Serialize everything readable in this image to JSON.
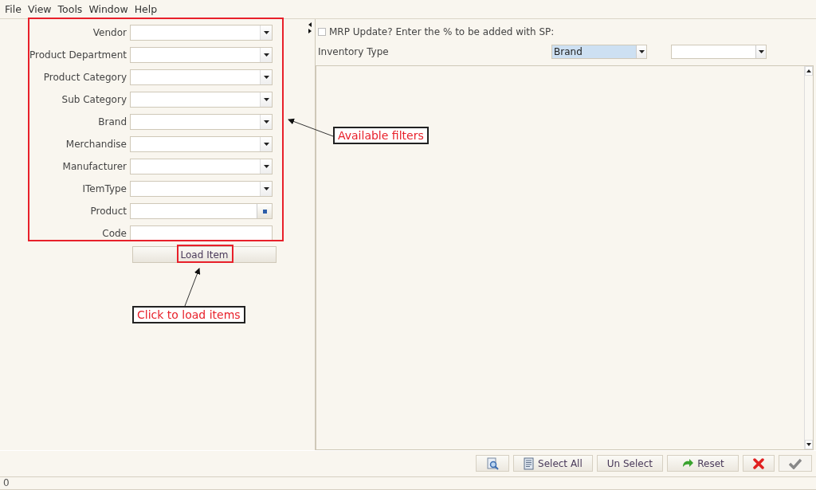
{
  "menu": [
    {
      "label": "File"
    },
    {
      "label": "View"
    },
    {
      "label": "Tools"
    },
    {
      "label": "Window"
    },
    {
      "label": "Help"
    }
  ],
  "filters": [
    {
      "label": "Vendor",
      "kind": "combo"
    },
    {
      "label": "Product Department",
      "kind": "combo"
    },
    {
      "label": "Product Category",
      "kind": "combo"
    },
    {
      "label": "Sub Category",
      "kind": "combo"
    },
    {
      "label": "Brand",
      "kind": "combo"
    },
    {
      "label": "Merchandise",
      "kind": "combo"
    },
    {
      "label": "Manufacturer",
      "kind": "combo"
    },
    {
      "label": "ITemType",
      "kind": "combo"
    },
    {
      "label": "Product",
      "kind": "lookup"
    },
    {
      "label": "Code",
      "kind": "text"
    }
  ],
  "load_button": {
    "label": "Load Item"
  },
  "mrp_update": {
    "label": "MRP Update? Enter the % to be added with SP:",
    "checked": false
  },
  "inventory_type": {
    "label": "Inventory Type",
    "value": "Brand"
  },
  "toolbar": [
    {
      "kind": "preview",
      "disabled": false
    },
    {
      "kind": "document",
      "label": "Select All",
      "disabled": false
    },
    {
      "kind": "plain",
      "label": "Un Select",
      "disabled": false
    },
    {
      "kind": "refresh",
      "label": "Reset",
      "disabled": false
    },
    {
      "kind": "close",
      "disabled": false
    },
    {
      "kind": "check",
      "disabled": true
    }
  ],
  "status_bar": {
    "text": "0"
  },
  "annotations": [
    {
      "kind": "filters",
      "text": "Available filters"
    },
    {
      "kind": "load",
      "text": "Click to load items"
    }
  ]
}
